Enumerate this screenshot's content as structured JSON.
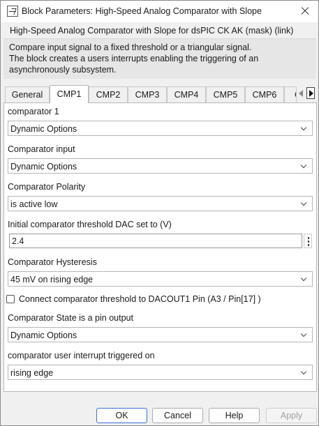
{
  "window": {
    "title": "Block Parameters: High-Speed Analog Comparator with Slope"
  },
  "header": {
    "mask_title": "High-Speed Analog Comparator with Slope for dsPIC CK  AK (mask) (link)",
    "description_lines": [
      "Compare input signal to a fixed threshold or a triangular signal.",
      "The block creates a users interrupts enabling the triggering of an",
      "asynchronously subsystem."
    ]
  },
  "tabs": [
    {
      "label": "General",
      "active": false
    },
    {
      "label": "CMP1",
      "active": true
    },
    {
      "label": "CMP2",
      "active": false
    },
    {
      "label": "CMP3",
      "active": false
    },
    {
      "label": "CMP4",
      "active": false
    },
    {
      "label": "CMP5",
      "active": false
    },
    {
      "label": "CMP6",
      "active": false
    },
    {
      "label": "C",
      "active": false
    }
  ],
  "params": {
    "comparator": {
      "label": "comparator 1",
      "value": "Dynamic Options"
    },
    "input": {
      "label": "Comparator input",
      "value": "Dynamic Options"
    },
    "polarity": {
      "label": "Comparator Polarity",
      "value": "is active low"
    },
    "threshold": {
      "label": "Initial comparator threshold DAC set to (V)",
      "value": "2.4"
    },
    "hysteresis": {
      "label": "Comparator Hysteresis",
      "value": "45 mV on rising edge"
    },
    "dacout": {
      "label": "Connect comparator threshold to DACOUT1 Pin (A3 / Pin[17] )",
      "checked": false
    },
    "state": {
      "label": "Comparator State is a pin output",
      "value": "Dynamic Options"
    },
    "interrupt": {
      "label": "comparator user interrupt triggered on",
      "value": "rising edge"
    }
  },
  "buttons": {
    "ok": "OK",
    "cancel": "Cancel",
    "help": "Help",
    "apply": "Apply"
  },
  "colors": {
    "accent": "#3a6fd8",
    "dialog_bg": "#f0f0f0",
    "description_bg": "#e6e6e6"
  }
}
